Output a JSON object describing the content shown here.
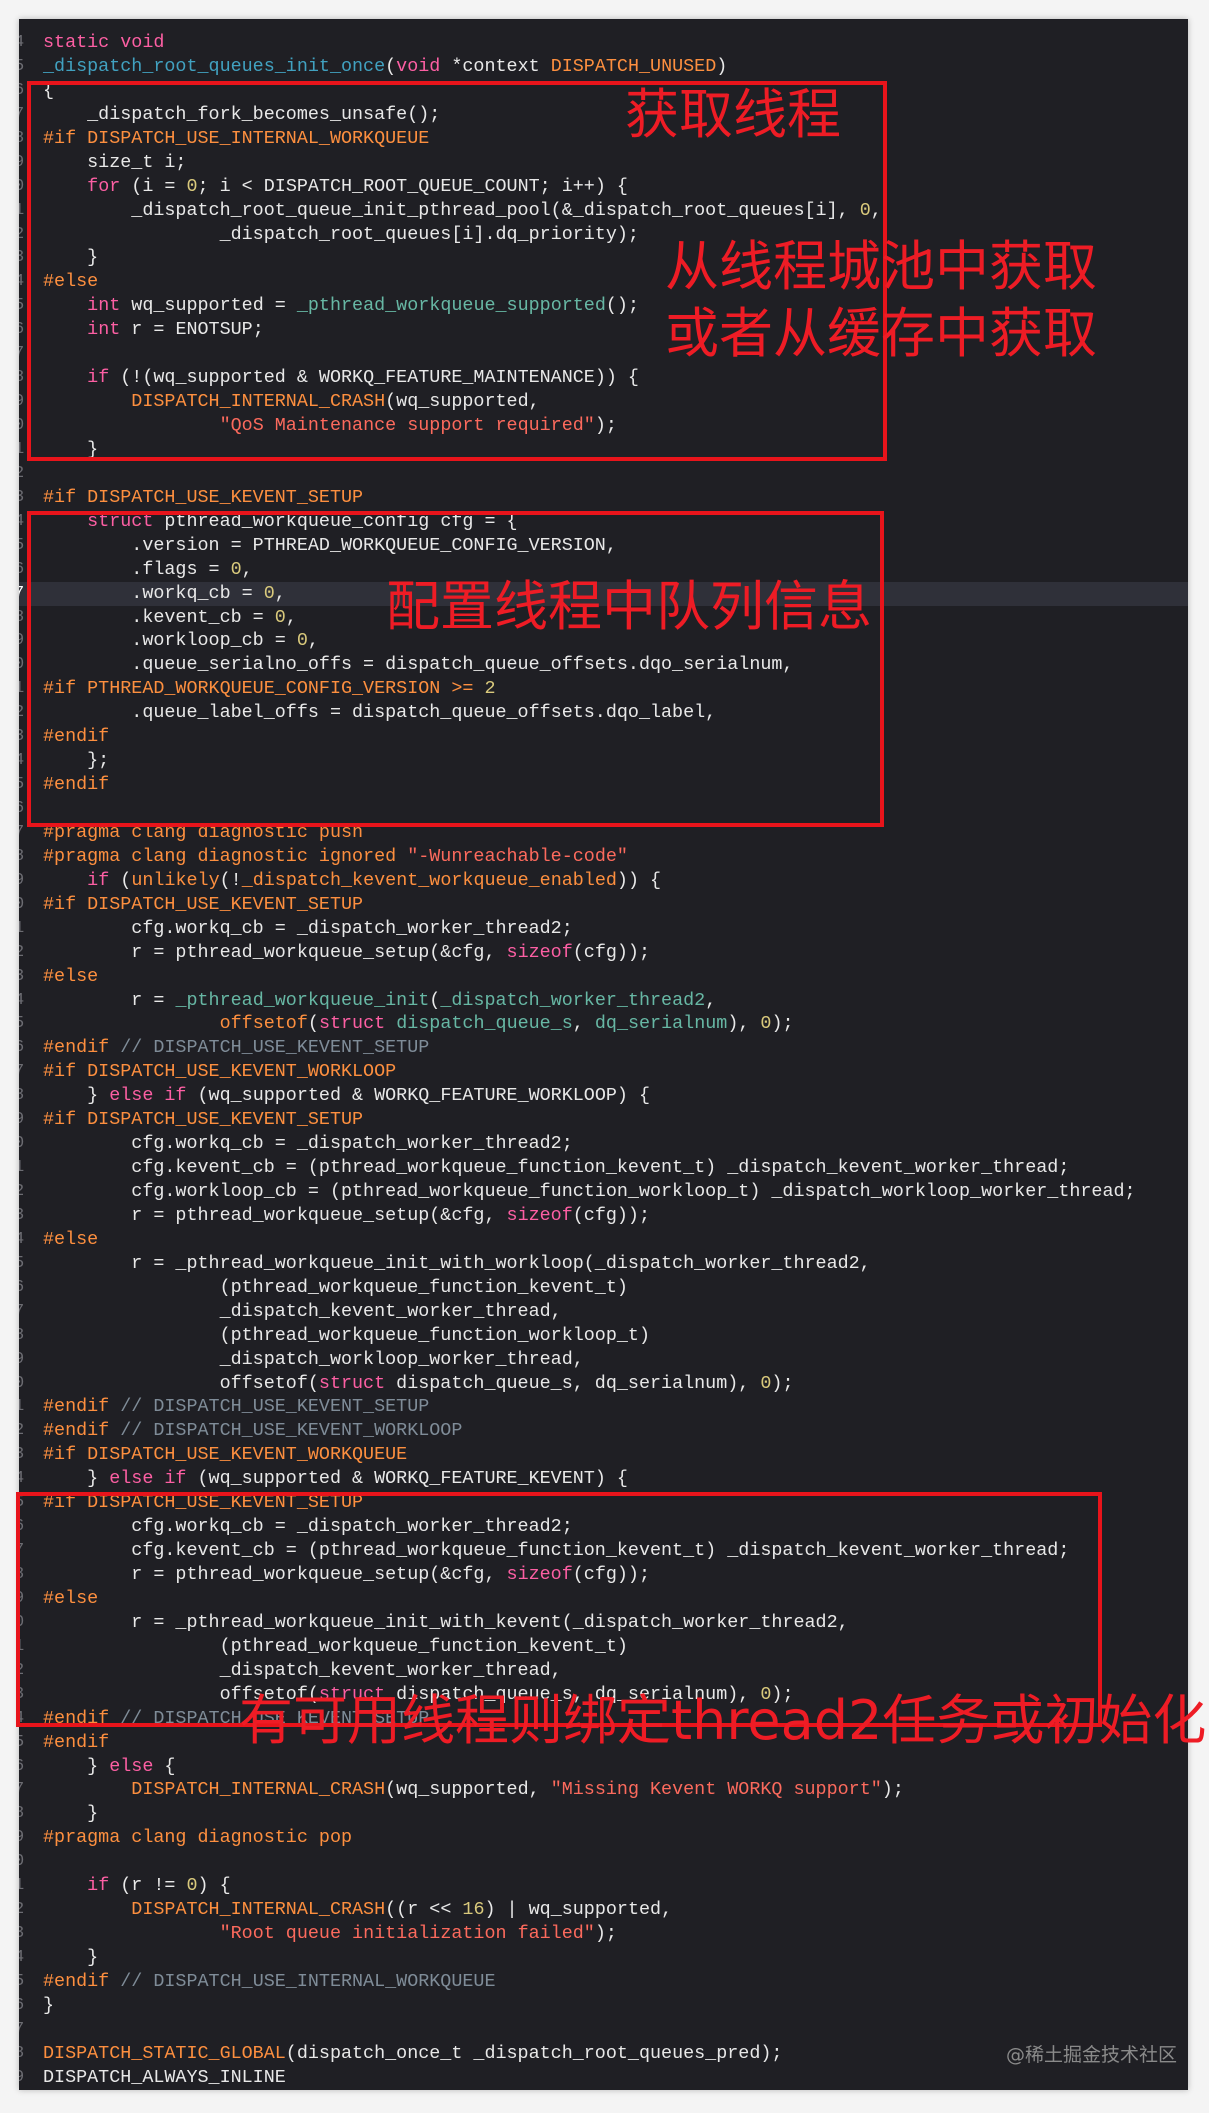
{
  "colors": {
    "keyword": "#fc5fa3",
    "preprocessor": "#fd8f3f",
    "function": "#67b7a4",
    "declaration": "#41a1c0",
    "number": "#d9c97c",
    "string": "#fc6a5d",
    "comment": "#7f8c98",
    "annotation": "#ee1c25",
    "background": "#1f1f24"
  },
  "highlighted_line_index": 23,
  "annotations": {
    "get_thread": "获取线程",
    "from_pool": "从线程城池中获取",
    "from_cache": "或者从缓存中获取",
    "config_queue": "配置线程中队列信息",
    "bind_thread2": "有可用线程则绑定thread2任务或初始化"
  },
  "watermark": "@稀土掘金技术社区",
  "lines": [
    {
      "n": "4",
      "t": [
        [
          "k",
          "static"
        ],
        " ",
        [
          "k",
          "void"
        ]
      ]
    },
    {
      "n": "5",
      "t": [
        [
          "d",
          "_dispatch_root_queues_init_once"
        ],
        "(",
        [
          "k",
          "void"
        ],
        " *context ",
        [
          "p",
          "DISPATCH_UNUSED"
        ],
        ")"
      ]
    },
    {
      "n": "6",
      "t": [
        "{"
      ]
    },
    {
      "n": "7",
      "t": [
        "    _dispatch_fork_becomes_unsafe();"
      ]
    },
    {
      "n": "8",
      "t": [
        [
          "p",
          "#if DISPATCH_USE_INTERNAL_WORKQUEUE"
        ]
      ]
    },
    {
      "n": "9",
      "t": [
        "    size_t i;"
      ]
    },
    {
      "n": "0",
      "t": [
        "    ",
        [
          "k",
          "for"
        ],
        " (i = ",
        [
          "n",
          "0"
        ],
        "; i < DISPATCH_ROOT_QUEUE_COUNT; i++) {"
      ]
    },
    {
      "n": "1",
      "t": [
        "        _dispatch_root_queue_init_pthread_pool(&_dispatch_root_queues[i], ",
        [
          "n",
          "0"
        ],
        ","
      ]
    },
    {
      "n": "2",
      "t": [
        "                _dispatch_root_queues[i].dq_priority);"
      ]
    },
    {
      "n": "3",
      "t": [
        "    }"
      ]
    },
    {
      "n": "4",
      "t": [
        [
          "p",
          "#else"
        ]
      ]
    },
    {
      "n": "5",
      "t": [
        "    ",
        [
          "k",
          "int"
        ],
        " wq_supported = ",
        [
          "f",
          "_pthread_workqueue_supported"
        ],
        "();"
      ]
    },
    {
      "n": "6",
      "t": [
        "    ",
        [
          "k",
          "int"
        ],
        " r = ENOTSUP;"
      ]
    },
    {
      "n": "7",
      "t": [
        ""
      ]
    },
    {
      "n": "8",
      "t": [
        "    ",
        [
          "k",
          "if"
        ],
        " (!(wq_supported & WORKQ_FEATURE_MAINTENANCE)) {"
      ]
    },
    {
      "n": "9",
      "t": [
        "        ",
        [
          "p",
          "DISPATCH_INTERNAL_CRASH"
        ],
        "(wq_supported,"
      ]
    },
    {
      "n": "0",
      "t": [
        "                ",
        [
          "s",
          "\"QoS Maintenance support required\""
        ],
        ");"
      ]
    },
    {
      "n": "1",
      "t": [
        "    }"
      ]
    },
    {
      "n": "2",
      "t": [
        ""
      ]
    },
    {
      "n": "3",
      "t": [
        [
          "p",
          "#if DISPATCH_USE_KEVENT_SETUP"
        ]
      ]
    },
    {
      "n": "4",
      "t": [
        "    ",
        [
          "k",
          "struct"
        ],
        " pthread_workqueue_config cfg = {"
      ]
    },
    {
      "n": "5",
      "t": [
        "        .version = PTHREAD_WORKQUEUE_CONFIG_VERSION,"
      ]
    },
    {
      "n": "6",
      "t": [
        "        .flags = ",
        [
          "n",
          "0"
        ],
        ","
      ]
    },
    {
      "n": "7",
      "t": [
        "        .workq_cb = ",
        [
          "n",
          "0"
        ],
        ","
      ]
    },
    {
      "n": "8",
      "t": [
        "        .kevent_cb = ",
        [
          "n",
          "0"
        ],
        ","
      ]
    },
    {
      "n": "9",
      "t": [
        "        .workloop_cb = ",
        [
          "n",
          "0"
        ],
        ","
      ]
    },
    {
      "n": "0",
      "t": [
        "        .queue_serialno_offs = dispatch_queue_offsets.dqo_serialnum,"
      ]
    },
    {
      "n": "1",
      "t": [
        [
          "p",
          "#if PTHREAD_WORKQUEUE_CONFIG_VERSION >= "
        ],
        [
          "n",
          "2"
        ]
      ]
    },
    {
      "n": "2",
      "t": [
        "        .queue_label_offs = dispatch_queue_offsets.dqo_label,"
      ]
    },
    {
      "n": "3",
      "t": [
        [
          "p",
          "#endif"
        ]
      ]
    },
    {
      "n": "4",
      "t": [
        "    };"
      ]
    },
    {
      "n": "5",
      "t": [
        [
          "p",
          "#endif"
        ]
      ]
    },
    {
      "n": "6",
      "t": [
        ""
      ]
    },
    {
      "n": "7",
      "t": [
        [
          "p",
          "#pragma clang diagnostic push"
        ]
      ]
    },
    {
      "n": "8",
      "t": [
        [
          "p",
          "#pragma clang diagnostic ignored "
        ],
        [
          "s",
          "\"-Wunreachable-code\""
        ]
      ]
    },
    {
      "n": "9",
      "t": [
        "    ",
        [
          "k",
          "if"
        ],
        " (",
        [
          "p",
          "unlikely"
        ],
        "(!",
        [
          "p",
          "_dispatch_kevent_workqueue_enabled"
        ],
        ")) {"
      ]
    },
    {
      "n": "0",
      "t": [
        [
          "p",
          "#if DISPATCH_USE_KEVENT_SETUP"
        ]
      ]
    },
    {
      "n": "1",
      "t": [
        "        cfg.workq_cb = _dispatch_worker_thread2;"
      ]
    },
    {
      "n": "2",
      "t": [
        "        r = pthread_workqueue_setup(&cfg, ",
        [
          "k",
          "sizeof"
        ],
        "(cfg));"
      ]
    },
    {
      "n": "3",
      "t": [
        [
          "p",
          "#else"
        ]
      ]
    },
    {
      "n": "4",
      "t": [
        "        r = ",
        [
          "f",
          "_pthread_workqueue_init"
        ],
        "(",
        [
          "f",
          "_dispatch_worker_thread2"
        ],
        ","
      ]
    },
    {
      "n": "5",
      "t": [
        "                ",
        [
          "p",
          "offsetof"
        ],
        "(",
        [
          "k",
          "struct"
        ],
        " ",
        [
          "f",
          "dispatch_queue_s"
        ],
        ", ",
        [
          "f",
          "dq_serialnum"
        ],
        "), ",
        [
          "n",
          "0"
        ],
        ");"
      ]
    },
    {
      "n": "6",
      "t": [
        [
          "p",
          "#endif"
        ],
        [
          "c",
          " // DISPATCH_USE_KEVENT_SETUP"
        ]
      ]
    },
    {
      "n": "7",
      "t": [
        [
          "p",
          "#if DISPATCH_USE_KEVENT_WORKLOOP"
        ]
      ]
    },
    {
      "n": "8",
      "t": [
        "    } ",
        [
          "k",
          "else if"
        ],
        " (wq_supported & WORKQ_FEATURE_WORKLOOP) {"
      ]
    },
    {
      "n": "9",
      "t": [
        [
          "p",
          "#if DISPATCH_USE_KEVENT_SETUP"
        ]
      ]
    },
    {
      "n": "0",
      "t": [
        "        cfg.workq_cb = _dispatch_worker_thread2;"
      ]
    },
    {
      "n": "1",
      "t": [
        "        cfg.kevent_cb = (pthread_workqueue_function_kevent_t) _dispatch_kevent_worker_thread;"
      ]
    },
    {
      "n": "2",
      "t": [
        "        cfg.workloop_cb = (pthread_workqueue_function_workloop_t) _dispatch_workloop_worker_thread;"
      ]
    },
    {
      "n": "3",
      "t": [
        "        r = pthread_workqueue_setup(&cfg, ",
        [
          "k",
          "sizeof"
        ],
        "(cfg));"
      ]
    },
    {
      "n": "4",
      "t": [
        [
          "p",
          "#else"
        ]
      ]
    },
    {
      "n": "5",
      "t": [
        "        r = _pthread_workqueue_init_with_workloop(_dispatch_worker_thread2,"
      ]
    },
    {
      "n": "6",
      "t": [
        "                (pthread_workqueue_function_kevent_t)"
      ]
    },
    {
      "n": "7",
      "t": [
        "                _dispatch_kevent_worker_thread,"
      ]
    },
    {
      "n": "8",
      "t": [
        "                (pthread_workqueue_function_workloop_t)"
      ]
    },
    {
      "n": "9",
      "t": [
        "                _dispatch_workloop_worker_thread,"
      ]
    },
    {
      "n": "0",
      "t": [
        "                offsetof(",
        [
          "k",
          "struct"
        ],
        " dispatch_queue_s, dq_serialnum), ",
        [
          "n",
          "0"
        ],
        ");"
      ]
    },
    {
      "n": "1",
      "t": [
        [
          "p",
          "#endif"
        ],
        [
          "c",
          " // DISPATCH_USE_KEVENT_SETUP"
        ]
      ]
    },
    {
      "n": "2",
      "t": [
        [
          "p",
          "#endif"
        ],
        [
          "c",
          " // DISPATCH_USE_KEVENT_WORKLOOP"
        ]
      ]
    },
    {
      "n": "3",
      "t": [
        [
          "p",
          "#if DISPATCH_USE_KEVENT_WORKQUEUE"
        ]
      ]
    },
    {
      "n": "4",
      "t": [
        "    } ",
        [
          "k",
          "else if"
        ],
        " (wq_supported & WORKQ_FEATURE_KEVENT) {"
      ]
    },
    {
      "n": "5",
      "t": [
        [
          "p",
          "#if DISPATCH_USE_KEVENT_SETUP"
        ]
      ]
    },
    {
      "n": "6",
      "t": [
        "        cfg.workq_cb = _dispatch_worker_thread2;"
      ]
    },
    {
      "n": "7",
      "t": [
        "        cfg.kevent_cb = (pthread_workqueue_function_kevent_t) _dispatch_kevent_worker_thread;"
      ]
    },
    {
      "n": "8",
      "t": [
        "        r = pthread_workqueue_setup(&cfg, ",
        [
          "k",
          "sizeof"
        ],
        "(cfg));"
      ]
    },
    {
      "n": "9",
      "t": [
        [
          "p",
          "#else"
        ]
      ]
    },
    {
      "n": "0",
      "t": [
        "        r = _pthread_workqueue_init_with_kevent(_dispatch_worker_thread2,"
      ]
    },
    {
      "n": "1",
      "t": [
        "                (pthread_workqueue_function_kevent_t)"
      ]
    },
    {
      "n": "2",
      "t": [
        "                _dispatch_kevent_worker_thread,"
      ]
    },
    {
      "n": "3",
      "t": [
        "                offsetof(",
        [
          "k",
          "struct"
        ],
        " dispatch_queue_s, dq_serialnum), ",
        [
          "n",
          "0"
        ],
        ");"
      ]
    },
    {
      "n": "4",
      "t": [
        [
          "p",
          "#endif"
        ],
        [
          "c",
          " // DISPATCH_USE_KEVENT_SETUP"
        ]
      ]
    },
    {
      "n": "5",
      "t": [
        [
          "p",
          "#endif"
        ]
      ]
    },
    {
      "n": "6",
      "t": [
        "    } ",
        [
          "k",
          "else"
        ],
        " {"
      ]
    },
    {
      "n": "7",
      "t": [
        "        ",
        [
          "p",
          "DISPATCH_INTERNAL_CRASH"
        ],
        "(wq_supported, ",
        [
          "s",
          "\"Missing Kevent WORKQ support\""
        ],
        ");"
      ]
    },
    {
      "n": "8",
      "t": [
        "    }"
      ]
    },
    {
      "n": "9",
      "t": [
        [
          "p",
          "#pragma clang diagnostic pop"
        ]
      ]
    },
    {
      "n": "0",
      "t": [
        ""
      ]
    },
    {
      "n": "1",
      "t": [
        "    ",
        [
          "k",
          "if"
        ],
        " (r != ",
        [
          "n",
          "0"
        ],
        ") {"
      ]
    },
    {
      "n": "2",
      "t": [
        "        ",
        [
          "p",
          "DISPATCH_INTERNAL_CRASH"
        ],
        "((r << ",
        [
          "n",
          "16"
        ],
        ") | wq_supported,"
      ]
    },
    {
      "n": "3",
      "t": [
        "                ",
        [
          "s",
          "\"Root queue initialization failed\""
        ],
        ");"
      ]
    },
    {
      "n": "4",
      "t": [
        "    }"
      ]
    },
    {
      "n": "5",
      "t": [
        [
          "p",
          "#endif"
        ],
        [
          "c",
          " // DISPATCH_USE_INTERNAL_WORKQUEUE"
        ]
      ]
    },
    {
      "n": "6",
      "t": [
        "}"
      ]
    },
    {
      "n": "7",
      "t": [
        ""
      ]
    },
    {
      "n": "8",
      "t": [
        [
          "p",
          "DISPATCH_STATIC_GLOBAL"
        ],
        "(dispatch_once_t _dispatch_root_queues_pred);"
      ]
    },
    {
      "n": "9",
      "t": [
        "DISPATCH_ALWAYS_INLINE"
      ]
    }
  ]
}
